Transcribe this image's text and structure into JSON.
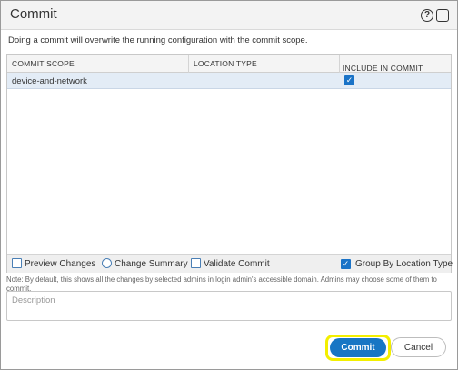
{
  "dialog": {
    "title": "Commit",
    "help_symbol": "?",
    "intro_text": "Doing a commit will overwrite the running configuration with the commit scope."
  },
  "table": {
    "columns": [
      "COMMIT SCOPE",
      "LOCATION TYPE",
      "INCLUDE IN COMMIT"
    ],
    "rows": [
      {
        "commit_scope": "device-and-network",
        "location_type": "",
        "include_in_commit": true
      }
    ]
  },
  "actions": {
    "preview_changes": "Preview Changes",
    "change_summary": "Change Summary",
    "validate_commit": "Validate Commit",
    "group_by_location_type": "Group By Location Type",
    "group_by_checked": true
  },
  "note_text": "Note: By default, this shows all the changes by selected admins in login admin's accessible domain. Admins may choose some of them to commit.",
  "description": {
    "placeholder": "Description",
    "value": ""
  },
  "buttons": {
    "commit": "Commit",
    "cancel": "Cancel"
  },
  "colors": {
    "accent": "#1776c4",
    "highlight": "#f3ef00",
    "selected_row": "#e3ecf6"
  }
}
